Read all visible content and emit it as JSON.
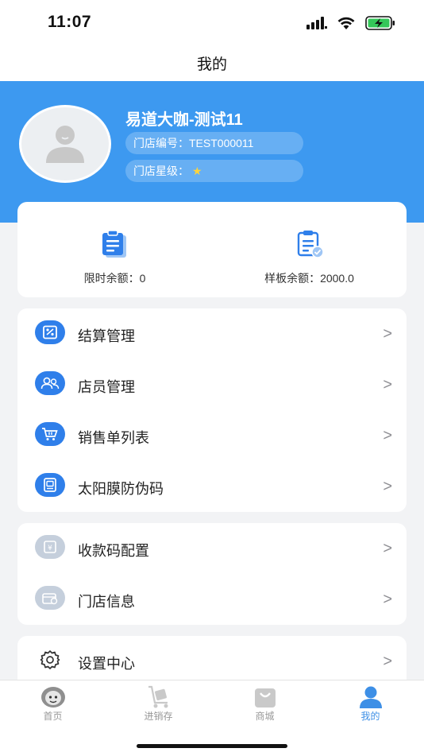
{
  "status": {
    "time": "11:07"
  },
  "nav": {
    "title": "我的"
  },
  "profile": {
    "name": "易道大咖-测试11",
    "store_no_label": "门店编号：",
    "store_no": "TEST000011",
    "store_level_label": "门店星级：",
    "stars": 1
  },
  "balance": {
    "limited": "限时余额：0",
    "template": "样板余额：2000.0"
  },
  "menu1": [
    {
      "label": "结算管理",
      "icon": "settlement-icon"
    },
    {
      "label": "店员管理",
      "icon": "staff-icon"
    },
    {
      "label": "销售单列表",
      "icon": "cart-icon"
    },
    {
      "label": "太阳膜防伪码",
      "icon": "anti-counterfeit-icon"
    }
  ],
  "menu2": [
    {
      "label": "收款码配置",
      "icon": "payment-code-icon"
    },
    {
      "label": "门店信息",
      "icon": "store-info-icon"
    }
  ],
  "menu3": [
    {
      "label": "设置中心",
      "icon": "gear-icon"
    }
  ],
  "chevron": ">",
  "tabs": [
    {
      "label": "首页",
      "icon": "home-avatar-icon"
    },
    {
      "label": "进销存",
      "icon": "inventory-cart-icon"
    },
    {
      "label": "商城",
      "icon": "shopping-bag-icon"
    },
    {
      "label": "我的",
      "icon": "user-icon",
      "active": true
    }
  ],
  "colors": {
    "primary": "#3d99f0",
    "icon_blue": "#2f7fea",
    "icon_gray": "#c5cfdc",
    "background": "#f2f3f5"
  }
}
